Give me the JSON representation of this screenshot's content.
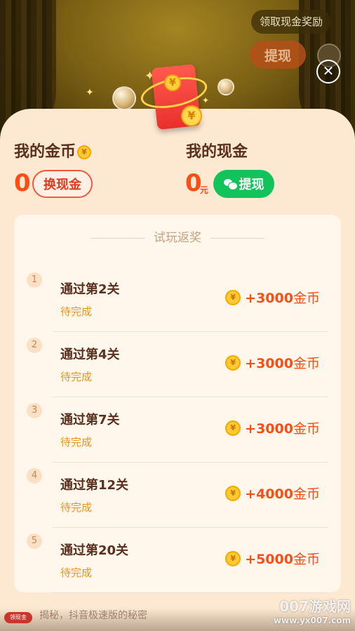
{
  "header": {
    "reward_badge": "领取现金奖励",
    "withdraw_label": "提现",
    "close_glyph": "✕"
  },
  "wallet": {
    "coins_title": "我的金币",
    "coins_value": "0",
    "exchange_label": "换现金",
    "cash_title": "我的现金",
    "cash_value": "0",
    "cash_unit": "元",
    "withdraw_label": "提现"
  },
  "tasks": {
    "heading": "试玩返奖",
    "items": [
      {
        "num": "1",
        "title": "通过第2关",
        "status": "待完成",
        "amount": "+3000",
        "unit": "金币"
      },
      {
        "num": "2",
        "title": "通过第4关",
        "status": "待完成",
        "amount": "+3000",
        "unit": "金币"
      },
      {
        "num": "3",
        "title": "通过第7关",
        "status": "待完成",
        "amount": "+3000",
        "unit": "金币"
      },
      {
        "num": "4",
        "title": "通过第12关",
        "status": "待完成",
        "amount": "+4000",
        "unit": "金币"
      },
      {
        "num": "5",
        "title": "通过第20关",
        "status": "待完成",
        "amount": "+5000",
        "unit": "金币"
      }
    ]
  },
  "icons": {
    "coin": "coin-icon",
    "close": "close-icon",
    "wechat": "wechat-icon"
  },
  "colors": {
    "accent": "#fb4d14",
    "green": "#12c25a",
    "panel": "#fde8d2"
  },
  "footer": {
    "ad_badge": "领现金",
    "ad_text": "揭秘，抖音极速版的秘密",
    "watermark_title": "007游戏网",
    "watermark_url": "www.yx007.com"
  }
}
